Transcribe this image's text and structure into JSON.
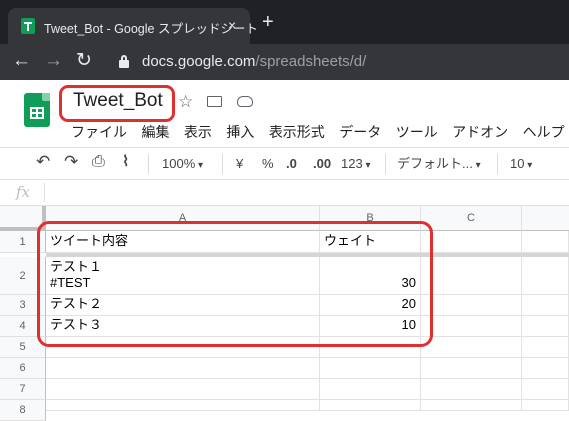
{
  "browser": {
    "tab_title": "Tweet_Bot - Google スプレッドシート",
    "tab_close": "×",
    "new_tab": "+",
    "back_icon": "←",
    "forward_icon": "→",
    "reload_icon": "↻",
    "url_host": "docs.google.com",
    "url_path": "/spreadsheets/d/"
  },
  "sheets": {
    "title": "Tweet_Bot",
    "menu": [
      "ファイル",
      "編集",
      "表示",
      "挿入",
      "表示形式",
      "データ",
      "ツール",
      "アドオン",
      "ヘルプ"
    ]
  },
  "toolbar": {
    "undo": "↶",
    "redo": "↷",
    "print": "⎙",
    "paint_format": "⌇",
    "zoom": "100%",
    "currency": "¥",
    "percent": "%",
    "dec_decrease": ".0",
    "dec_increase": ".00",
    "more_formats": "123",
    "font": "デフォルト...",
    "font_size": "10"
  },
  "formula_bar": {
    "fx": "fx",
    "value": ""
  },
  "grid": {
    "columns": [
      "A",
      "B",
      "C"
    ],
    "rows": [
      "1",
      "2",
      "3",
      "4",
      "5",
      "6",
      "7",
      "8"
    ],
    "header_row": {
      "a": "ツイート内容",
      "b": "ウェイト"
    },
    "data": [
      {
        "a": "テスト１\n#TEST",
        "b": "30"
      },
      {
        "a": "テスト２",
        "b": "20"
      },
      {
        "a": "テスト３",
        "b": "10"
      }
    ]
  },
  "colors": {
    "highlight": "#e02f2f",
    "sheets_green": "#0f9d58",
    "chrome_dark": "#202124"
  }
}
